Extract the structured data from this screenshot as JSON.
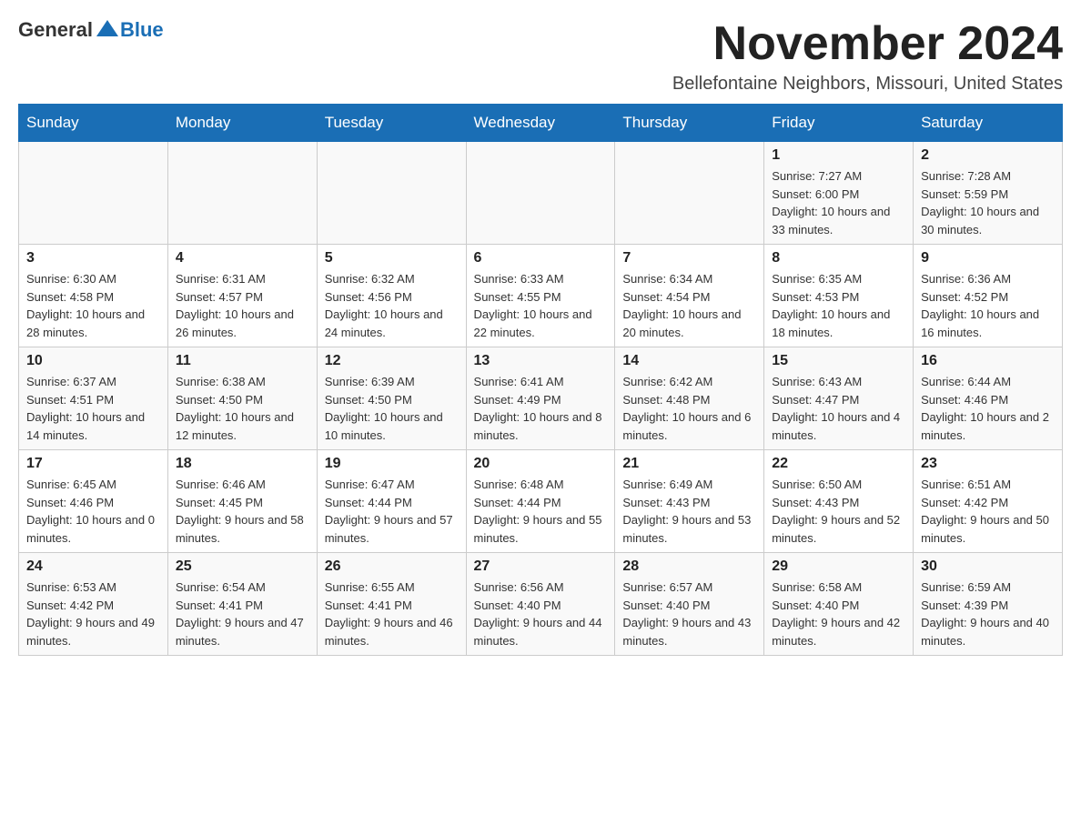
{
  "header": {
    "logo": {
      "general": "General",
      "blue": "Blue"
    },
    "month_title": "November 2024",
    "location": "Bellefontaine Neighbors, Missouri, United States"
  },
  "weekdays": [
    "Sunday",
    "Monday",
    "Tuesday",
    "Wednesday",
    "Thursday",
    "Friday",
    "Saturday"
  ],
  "weeks": [
    [
      {
        "day": "",
        "sunrise": "",
        "sunset": "",
        "daylight": ""
      },
      {
        "day": "",
        "sunrise": "",
        "sunset": "",
        "daylight": ""
      },
      {
        "day": "",
        "sunrise": "",
        "sunset": "",
        "daylight": ""
      },
      {
        "day": "",
        "sunrise": "",
        "sunset": "",
        "daylight": ""
      },
      {
        "day": "",
        "sunrise": "",
        "sunset": "",
        "daylight": ""
      },
      {
        "day": "1",
        "sunrise": "Sunrise: 7:27 AM",
        "sunset": "Sunset: 6:00 PM",
        "daylight": "Daylight: 10 hours and 33 minutes."
      },
      {
        "day": "2",
        "sunrise": "Sunrise: 7:28 AM",
        "sunset": "Sunset: 5:59 PM",
        "daylight": "Daylight: 10 hours and 30 minutes."
      }
    ],
    [
      {
        "day": "3",
        "sunrise": "Sunrise: 6:30 AM",
        "sunset": "Sunset: 4:58 PM",
        "daylight": "Daylight: 10 hours and 28 minutes."
      },
      {
        "day": "4",
        "sunrise": "Sunrise: 6:31 AM",
        "sunset": "Sunset: 4:57 PM",
        "daylight": "Daylight: 10 hours and 26 minutes."
      },
      {
        "day": "5",
        "sunrise": "Sunrise: 6:32 AM",
        "sunset": "Sunset: 4:56 PM",
        "daylight": "Daylight: 10 hours and 24 minutes."
      },
      {
        "day": "6",
        "sunrise": "Sunrise: 6:33 AM",
        "sunset": "Sunset: 4:55 PM",
        "daylight": "Daylight: 10 hours and 22 minutes."
      },
      {
        "day": "7",
        "sunrise": "Sunrise: 6:34 AM",
        "sunset": "Sunset: 4:54 PM",
        "daylight": "Daylight: 10 hours and 20 minutes."
      },
      {
        "day": "8",
        "sunrise": "Sunrise: 6:35 AM",
        "sunset": "Sunset: 4:53 PM",
        "daylight": "Daylight: 10 hours and 18 minutes."
      },
      {
        "day": "9",
        "sunrise": "Sunrise: 6:36 AM",
        "sunset": "Sunset: 4:52 PM",
        "daylight": "Daylight: 10 hours and 16 minutes."
      }
    ],
    [
      {
        "day": "10",
        "sunrise": "Sunrise: 6:37 AM",
        "sunset": "Sunset: 4:51 PM",
        "daylight": "Daylight: 10 hours and 14 minutes."
      },
      {
        "day": "11",
        "sunrise": "Sunrise: 6:38 AM",
        "sunset": "Sunset: 4:50 PM",
        "daylight": "Daylight: 10 hours and 12 minutes."
      },
      {
        "day": "12",
        "sunrise": "Sunrise: 6:39 AM",
        "sunset": "Sunset: 4:50 PM",
        "daylight": "Daylight: 10 hours and 10 minutes."
      },
      {
        "day": "13",
        "sunrise": "Sunrise: 6:41 AM",
        "sunset": "Sunset: 4:49 PM",
        "daylight": "Daylight: 10 hours and 8 minutes."
      },
      {
        "day": "14",
        "sunrise": "Sunrise: 6:42 AM",
        "sunset": "Sunset: 4:48 PM",
        "daylight": "Daylight: 10 hours and 6 minutes."
      },
      {
        "day": "15",
        "sunrise": "Sunrise: 6:43 AM",
        "sunset": "Sunset: 4:47 PM",
        "daylight": "Daylight: 10 hours and 4 minutes."
      },
      {
        "day": "16",
        "sunrise": "Sunrise: 6:44 AM",
        "sunset": "Sunset: 4:46 PM",
        "daylight": "Daylight: 10 hours and 2 minutes."
      }
    ],
    [
      {
        "day": "17",
        "sunrise": "Sunrise: 6:45 AM",
        "sunset": "Sunset: 4:46 PM",
        "daylight": "Daylight: 10 hours and 0 minutes."
      },
      {
        "day": "18",
        "sunrise": "Sunrise: 6:46 AM",
        "sunset": "Sunset: 4:45 PM",
        "daylight": "Daylight: 9 hours and 58 minutes."
      },
      {
        "day": "19",
        "sunrise": "Sunrise: 6:47 AM",
        "sunset": "Sunset: 4:44 PM",
        "daylight": "Daylight: 9 hours and 57 minutes."
      },
      {
        "day": "20",
        "sunrise": "Sunrise: 6:48 AM",
        "sunset": "Sunset: 4:44 PM",
        "daylight": "Daylight: 9 hours and 55 minutes."
      },
      {
        "day": "21",
        "sunrise": "Sunrise: 6:49 AM",
        "sunset": "Sunset: 4:43 PM",
        "daylight": "Daylight: 9 hours and 53 minutes."
      },
      {
        "day": "22",
        "sunrise": "Sunrise: 6:50 AM",
        "sunset": "Sunset: 4:43 PM",
        "daylight": "Daylight: 9 hours and 52 minutes."
      },
      {
        "day": "23",
        "sunrise": "Sunrise: 6:51 AM",
        "sunset": "Sunset: 4:42 PM",
        "daylight": "Daylight: 9 hours and 50 minutes."
      }
    ],
    [
      {
        "day": "24",
        "sunrise": "Sunrise: 6:53 AM",
        "sunset": "Sunset: 4:42 PM",
        "daylight": "Daylight: 9 hours and 49 minutes."
      },
      {
        "day": "25",
        "sunrise": "Sunrise: 6:54 AM",
        "sunset": "Sunset: 4:41 PM",
        "daylight": "Daylight: 9 hours and 47 minutes."
      },
      {
        "day": "26",
        "sunrise": "Sunrise: 6:55 AM",
        "sunset": "Sunset: 4:41 PM",
        "daylight": "Daylight: 9 hours and 46 minutes."
      },
      {
        "day": "27",
        "sunrise": "Sunrise: 6:56 AM",
        "sunset": "Sunset: 4:40 PM",
        "daylight": "Daylight: 9 hours and 44 minutes."
      },
      {
        "day": "28",
        "sunrise": "Sunrise: 6:57 AM",
        "sunset": "Sunset: 4:40 PM",
        "daylight": "Daylight: 9 hours and 43 minutes."
      },
      {
        "day": "29",
        "sunrise": "Sunrise: 6:58 AM",
        "sunset": "Sunset: 4:40 PM",
        "daylight": "Daylight: 9 hours and 42 minutes."
      },
      {
        "day": "30",
        "sunrise": "Sunrise: 6:59 AM",
        "sunset": "Sunset: 4:39 PM",
        "daylight": "Daylight: 9 hours and 40 minutes."
      }
    ]
  ]
}
